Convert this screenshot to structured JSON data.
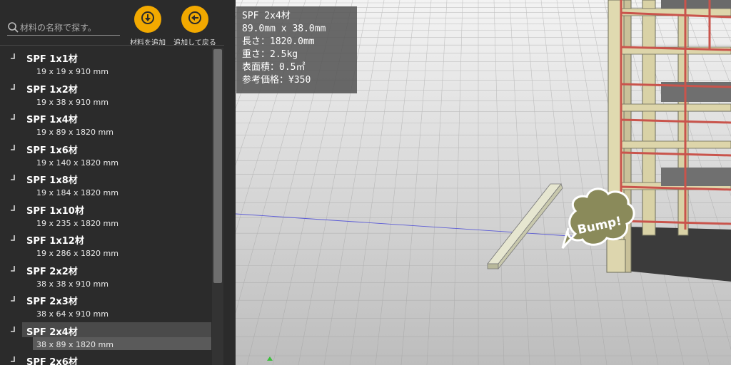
{
  "search": {
    "placeholder": "材料の名称で探す。"
  },
  "toolbar": {
    "add_label": "材料を追加",
    "add_back_label": "追加して戻る"
  },
  "materials": [
    {
      "name": "SPF 1x1材",
      "dims": "19 x 19 x 910 mm"
    },
    {
      "name": "SPF 1x2材",
      "dims": "19 x 38 x 910 mm"
    },
    {
      "name": "SPF 1x4材",
      "dims": "19 x 89 x 1820 mm"
    },
    {
      "name": "SPF 1x6材",
      "dims": "19 x 140 x 1820 mm"
    },
    {
      "name": "SPF 1x8材",
      "dims": "19 x 184 x 1820 mm"
    },
    {
      "name": "SPF 1x10材",
      "dims": "19 x 235 x 1820 mm"
    },
    {
      "name": "SPF 1x12材",
      "dims": "19 x 286 x 1820 mm"
    },
    {
      "name": "SPF 2x2材",
      "dims": "38 x 38 x 910 mm"
    },
    {
      "name": "SPF 2x3材",
      "dims": "38 x 64 x 910 mm"
    },
    {
      "name": "SPF 2x4材",
      "dims": "38 x 89 x 1820 mm",
      "selected": true
    },
    {
      "name": "SPF 2x6材",
      "dims": ""
    }
  ],
  "info": {
    "title": "SPF 2x4材",
    "section": "89.0mm x 38.0mm",
    "length": "長さ：1820.0mm",
    "weight": "重さ：2.5kg",
    "area": "表面積：0.5㎡",
    "price": "参考価格：¥350"
  },
  "bump_label": "Bump!",
  "colors": {
    "accent": "#f2a900",
    "panel": "#2b2b2b",
    "frame_red": "#c9544c"
  },
  "icons": {
    "search": "search-icon",
    "add": "download-arrow-icon",
    "add_back": "back-arrow-icon"
  }
}
